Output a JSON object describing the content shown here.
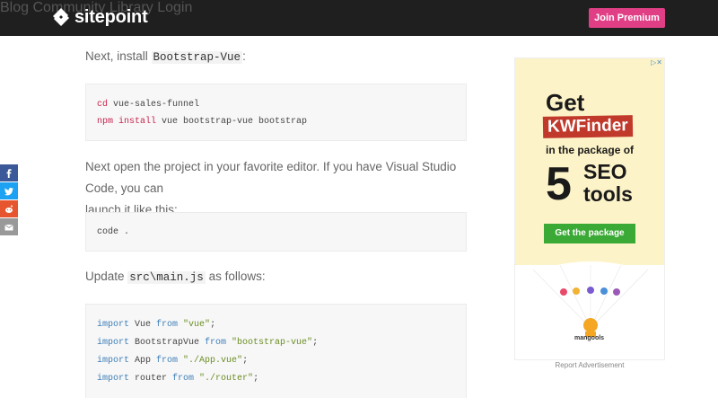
{
  "header": {
    "logo_text": "sitepoint",
    "nav": [
      "Blog",
      "Community",
      "Library",
      "Login"
    ],
    "join_label": "Join Premium"
  },
  "share": {
    "icons": [
      "facebook-icon",
      "twitter-icon",
      "reddit-icon",
      "email-icon"
    ],
    "colors": [
      "#3b5998",
      "#1da1f2",
      "#e6552d",
      "#999999"
    ]
  },
  "article": {
    "p1_prefix": "Next, install ",
    "p1_code": "Bootstrap-Vue",
    "p1_suffix": ":",
    "code1": [
      {
        "kw": "cd",
        "rest": " vue-sales-funnel"
      },
      {
        "kw": "npm install",
        "rest": " vue bootstrap-vue bootstrap"
      }
    ],
    "p2_line1": "Next open the project in your favorite editor. If you have Visual Studio Code, you can",
    "p2_line2": "launch it like this:",
    "code2": "code .",
    "p3_prefix": "Update ",
    "p3_code": "src\\main.js",
    "p3_suffix": " as follows:",
    "code3": [
      {
        "kw": "import",
        "name": " Vue ",
        "from": "from",
        "str": " \"vue\"",
        "end": ";"
      },
      {
        "kw": "import",
        "name": " BootstrapVue ",
        "from": "from",
        "str": " \"bootstrap-vue\"",
        "end": ";"
      },
      {
        "kw": "import",
        "name": " App ",
        "from": "from",
        "str": " \"./App.vue\"",
        "end": ";"
      },
      {
        "kw": "import",
        "name": " router ",
        "from": "from",
        "str": " \"./router\"",
        "end": ";"
      }
    ]
  },
  "ad": {
    "close": "▷✕",
    "get": "Get",
    "brand_box": "KWFinder",
    "package_line": "in the package of",
    "big_number": "5",
    "seo_line1": "SEO",
    "seo_line2": "tools",
    "cta": "Get the package",
    "brand": "mangools",
    "report": "Report Advertisement"
  }
}
